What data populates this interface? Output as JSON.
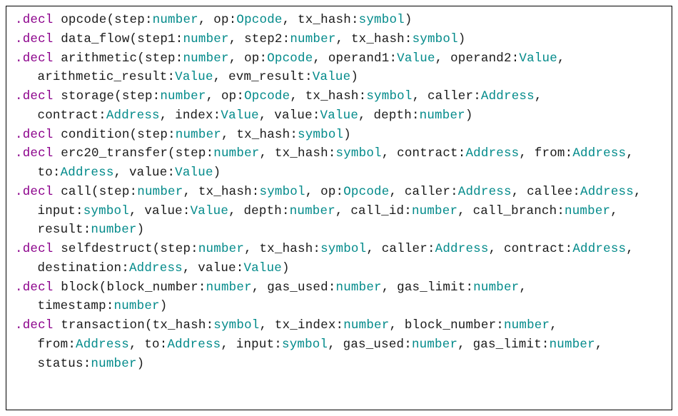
{
  "declarations": [
    {
      "keyword": ".decl",
      "name": "opcode",
      "params": [
        {
          "pname": "step",
          "ptype": "number"
        },
        {
          "pname": "op",
          "ptype": "Opcode"
        },
        {
          "pname": "tx_hash",
          "ptype": "symbol"
        }
      ]
    },
    {
      "keyword": ".decl",
      "name": "data_flow",
      "params": [
        {
          "pname": "step1",
          "ptype": "number"
        },
        {
          "pname": "step2",
          "ptype": "number"
        },
        {
          "pname": "tx_hash",
          "ptype": "symbol"
        }
      ]
    },
    {
      "keyword": ".decl",
      "name": "arithmetic",
      "params": [
        {
          "pname": "step",
          "ptype": "number"
        },
        {
          "pname": "op",
          "ptype": "Opcode"
        },
        {
          "pname": "operand1",
          "ptype": "Value"
        },
        {
          "pname": "operand2",
          "ptype": "Value"
        },
        {
          "pname": "arithmetic_result",
          "ptype": "Value"
        },
        {
          "pname": "evm_result",
          "ptype": "Value"
        }
      ]
    },
    {
      "keyword": ".decl",
      "name": "storage",
      "params": [
        {
          "pname": "step",
          "ptype": "number"
        },
        {
          "pname": "op",
          "ptype": "Opcode"
        },
        {
          "pname": "tx_hash",
          "ptype": "symbol"
        },
        {
          "pname": "caller",
          "ptype": "Address"
        },
        {
          "pname": "contract",
          "ptype": "Address"
        },
        {
          "pname": "index",
          "ptype": "Value"
        },
        {
          "pname": "value",
          "ptype": "Value"
        },
        {
          "pname": "depth",
          "ptype": "number"
        }
      ]
    },
    {
      "keyword": ".decl",
      "name": "condition",
      "params": [
        {
          "pname": "step",
          "ptype": "number"
        },
        {
          "pname": "tx_hash",
          "ptype": "symbol"
        }
      ]
    },
    {
      "keyword": ".decl",
      "name": "erc20_transfer",
      "params": [
        {
          "pname": "step",
          "ptype": "number"
        },
        {
          "pname": "tx_hash",
          "ptype": "symbol"
        },
        {
          "pname": "contract",
          "ptype": "Address"
        },
        {
          "pname": "from",
          "ptype": "Address"
        },
        {
          "pname": "to",
          "ptype": "Address"
        },
        {
          "pname": "value",
          "ptype": "Value"
        }
      ]
    },
    {
      "keyword": ".decl",
      "name": "call",
      "params": [
        {
          "pname": "step",
          "ptype": "number"
        },
        {
          "pname": "tx_hash",
          "ptype": "symbol"
        },
        {
          "pname": "op",
          "ptype": "Opcode"
        },
        {
          "pname": "caller",
          "ptype": "Address"
        },
        {
          "pname": "callee",
          "ptype": "Address"
        },
        {
          "pname": "input",
          "ptype": "symbol"
        },
        {
          "pname": "value",
          "ptype": "Value"
        },
        {
          "pname": "depth",
          "ptype": "number"
        },
        {
          "pname": "call_id",
          "ptype": "number"
        },
        {
          "pname": "call_branch",
          "ptype": "number"
        },
        {
          "pname": "result",
          "ptype": "number"
        }
      ]
    },
    {
      "keyword": ".decl",
      "name": "selfdestruct",
      "params": [
        {
          "pname": "step",
          "ptype": "number"
        },
        {
          "pname": "tx_hash",
          "ptype": "symbol"
        },
        {
          "pname": "caller",
          "ptype": "Address"
        },
        {
          "pname": "contract",
          "ptype": "Address"
        },
        {
          "pname": "destination",
          "ptype": "Address"
        },
        {
          "pname": "value",
          "ptype": "Value"
        }
      ]
    },
    {
      "keyword": ".decl",
      "name": "block",
      "params": [
        {
          "pname": "block_number",
          "ptype": "number"
        },
        {
          "pname": "gas_used",
          "ptype": "number"
        },
        {
          "pname": "gas_limit",
          "ptype": "number"
        },
        {
          "pname": "timestamp",
          "ptype": "number"
        }
      ]
    },
    {
      "keyword": ".decl",
      "name": "transaction",
      "params": [
        {
          "pname": "tx_hash",
          "ptype": "symbol"
        },
        {
          "pname": "tx_index",
          "ptype": "number"
        },
        {
          "pname": "block_number",
          "ptype": "number"
        },
        {
          "pname": "from",
          "ptype": "Address"
        },
        {
          "pname": "to",
          "ptype": "Address"
        },
        {
          "pname": "input",
          "ptype": "symbol"
        },
        {
          "pname": "gas_used",
          "ptype": "number"
        },
        {
          "pname": "gas_limit",
          "ptype": "number"
        },
        {
          "pname": "status",
          "ptype": "number"
        }
      ]
    }
  ]
}
